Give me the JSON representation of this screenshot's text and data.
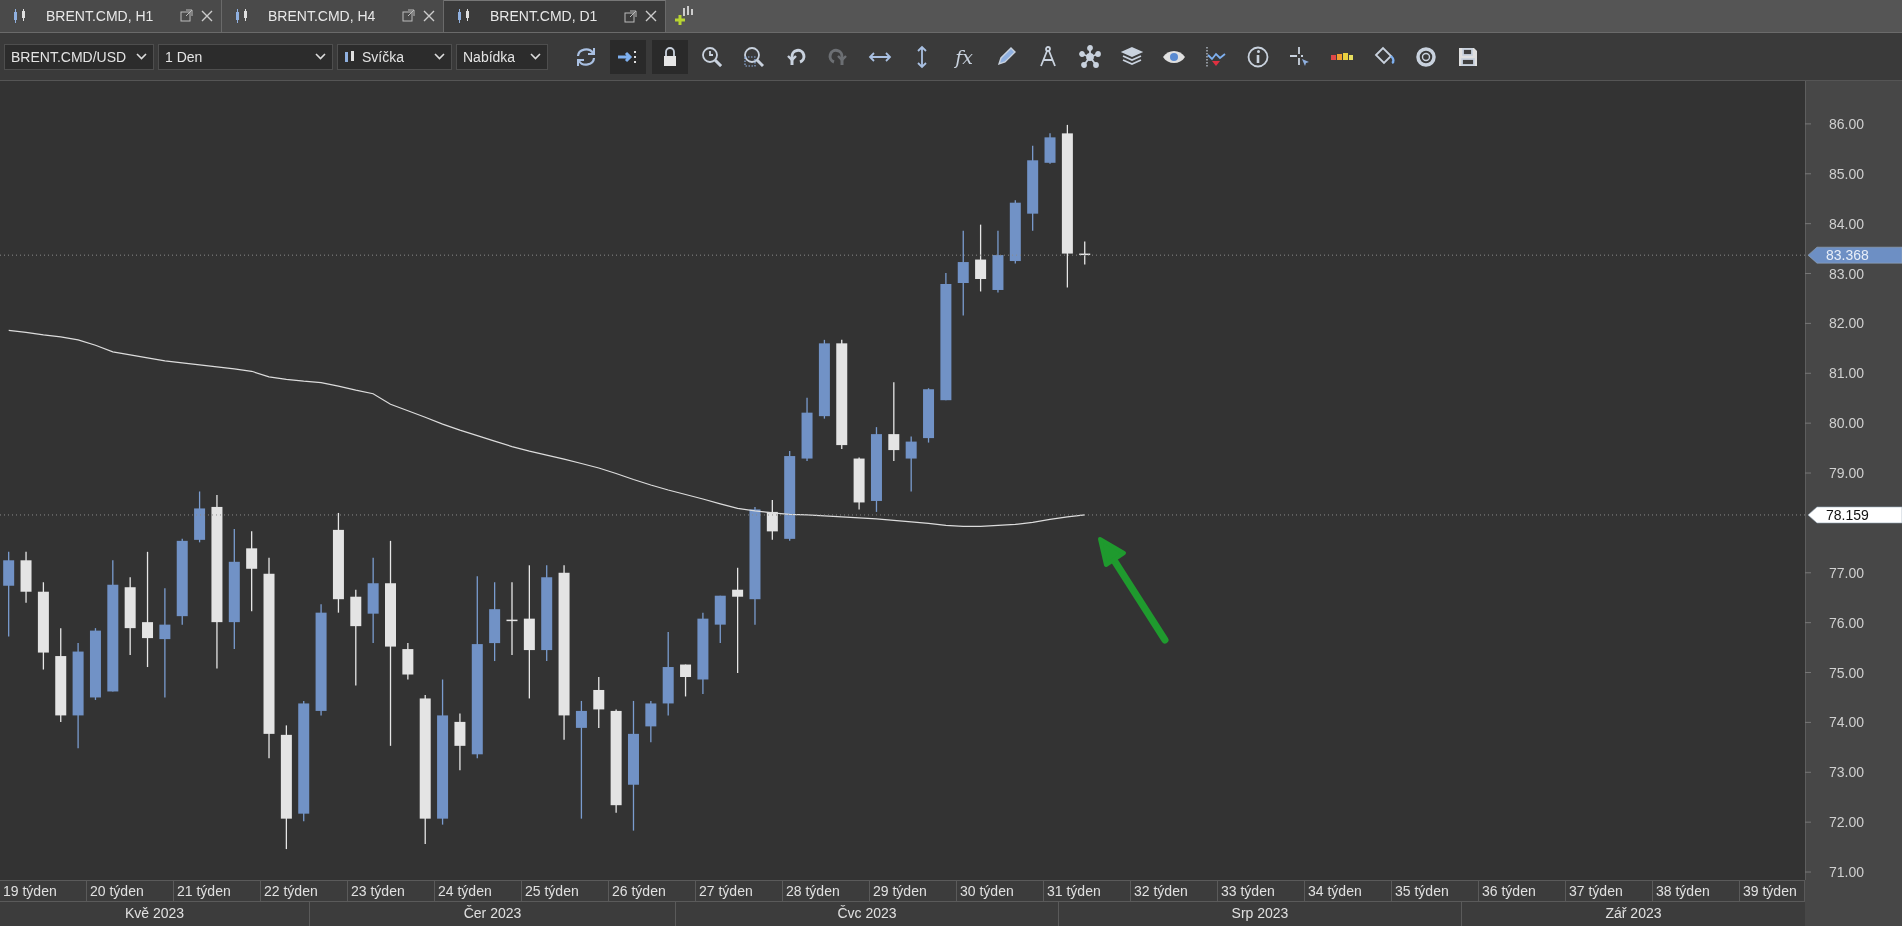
{
  "tabs": [
    {
      "label": "BRENT.CMD, H1",
      "selected": false
    },
    {
      "label": "BRENT.CMD, H4",
      "selected": false
    },
    {
      "label": "BRENT.CMD, D1",
      "selected": true
    }
  ],
  "toolbar": {
    "dropdowns": [
      {
        "kind": "plain",
        "value": "BRENT.CMD/USD"
      },
      {
        "kind": "plain",
        "value": "1 Den"
      },
      {
        "kind": "chart-type",
        "value": "Svíčka"
      },
      {
        "kind": "plain",
        "value": "Nabídka"
      }
    ],
    "tools": [
      {
        "kind": "refresh",
        "pressed": false,
        "disabled": false
      },
      {
        "kind": "autoscroll",
        "pressed": true,
        "disabled": false
      },
      {
        "kind": "lock",
        "pressed": true,
        "disabled": false
      },
      {
        "kind": "zoom-in",
        "pressed": false,
        "disabled": false
      },
      {
        "kind": "zoom-area",
        "pressed": false,
        "disabled": false
      },
      {
        "kind": "undo",
        "pressed": false,
        "disabled": false
      },
      {
        "kind": "redo",
        "pressed": false,
        "disabled": true
      },
      {
        "kind": "fit-horizontal",
        "pressed": false,
        "disabled": false
      },
      {
        "kind": "fit-vertical",
        "pressed": false,
        "disabled": false
      },
      {
        "kind": "formula",
        "label": "fx",
        "pressed": false,
        "disabled": false
      },
      {
        "kind": "pencil",
        "pressed": false,
        "disabled": false
      },
      {
        "kind": "compass",
        "pressed": false,
        "disabled": false
      },
      {
        "kind": "nodes",
        "pressed": false,
        "disabled": false
      },
      {
        "kind": "layers",
        "pressed": false,
        "disabled": false
      },
      {
        "kind": "eye",
        "pressed": false,
        "disabled": false
      },
      {
        "kind": "wave",
        "pressed": false,
        "disabled": false
      },
      {
        "kind": "info",
        "pressed": false,
        "disabled": false
      },
      {
        "kind": "crosshair",
        "pressed": false,
        "disabled": false
      },
      {
        "kind": "color-bar",
        "pressed": false,
        "disabled": false
      },
      {
        "kind": "bucket",
        "pressed": false,
        "disabled": false
      },
      {
        "kind": "aperture",
        "pressed": false,
        "disabled": false
      },
      {
        "kind": "save",
        "pressed": false,
        "disabled": false
      }
    ]
  },
  "chart": {
    "chart_data": {
      "type": "candlestick",
      "ylim": [
        70.84,
        86.86
      ],
      "yticks": [
        {
          "value": 86,
          "label": "86.00"
        },
        {
          "value": 85,
          "label": "85.00"
        },
        {
          "value": 84,
          "label": "84.00"
        },
        {
          "value": 83,
          "label": "83.00"
        },
        {
          "value": 82,
          "label": "82.00"
        },
        {
          "value": 81,
          "label": "81.00"
        },
        {
          "value": 80,
          "label": "80.00"
        },
        {
          "value": 79,
          "label": "79.00"
        },
        {
          "value": 77,
          "label": "77.00"
        },
        {
          "value": 76,
          "label": "76.00"
        },
        {
          "value": 75,
          "label": "75.00"
        },
        {
          "value": 74,
          "label": "74.00"
        },
        {
          "value": 73,
          "label": "73.00"
        },
        {
          "value": 72,
          "label": "72.00"
        },
        {
          "value": 71,
          "label": "71.00"
        }
      ],
      "categories": [
        null,
        null,
        null,
        null,
        null,
        null,
        null,
        null,
        null,
        null,
        null,
        null,
        null,
        null,
        null,
        null,
        null,
        null,
        null,
        null,
        null,
        null,
        null,
        null,
        null,
        null,
        null,
        null,
        null,
        null,
        null,
        null,
        null,
        null,
        null,
        null,
        null,
        null,
        null,
        null,
        null,
        null,
        null,
        null,
        null,
        null,
        null,
        null,
        null,
        null,
        null,
        null,
        null,
        null,
        null,
        null,
        null,
        null,
        null,
        null,
        null,
        null,
        null,
        null,
        null,
        null,
        null,
        null,
        null,
        null,
        null,
        null,
        null,
        null,
        null,
        null,
        null,
        null,
        null,
        null,
        null,
        null,
        null,
        null,
        null,
        null,
        null,
        null,
        null,
        null,
        null,
        null,
        null,
        null,
        null,
        null,
        null,
        null,
        null,
        null,
        null,
        null,
        null,
        null
      ],
      "ohlc": [
        [
          76.74,
          77.42,
          75.72,
          77.25
        ],
        [
          77.25,
          77.42,
          76.4,
          76.62
        ],
        [
          76.62,
          76.81,
          75.06,
          75.4
        ],
        [
          75.33,
          75.89,
          74.01,
          74.14
        ],
        [
          74.14,
          75.59,
          73.48,
          75.42
        ],
        [
          74.5,
          75.89,
          74.45,
          75.84
        ],
        [
          74.62,
          77.25,
          74.62,
          76.76
        ],
        [
          76.71,
          76.91,
          75.35,
          75.89
        ],
        [
          76.01,
          77.42,
          75.11,
          75.69
        ],
        [
          75.67,
          76.69,
          74.5,
          75.96
        ],
        [
          76.13,
          77.68,
          75.96,
          77.64
        ],
        [
          77.66,
          78.63,
          77.61,
          78.29
        ],
        [
          78.32,
          78.56,
          75.08,
          76.01
        ],
        [
          76.01,
          77.88,
          75.47,
          77.22
        ],
        [
          77.49,
          77.83,
          76.23,
          77.08
        ],
        [
          76.98,
          77.3,
          73.28,
          73.77
        ],
        [
          73.75,
          73.94,
          71.46,
          72.07
        ],
        [
          72.17,
          74.43,
          72.02,
          74.38
        ],
        [
          74.23,
          76.37,
          74.14,
          76.2
        ],
        [
          77.86,
          78.2,
          76.2,
          76.47
        ],
        [
          76.52,
          76.66,
          74.74,
          75.93
        ],
        [
          76.18,
          77.3,
          75.59,
          76.79
        ],
        [
          76.79,
          77.64,
          73.53,
          75.52
        ],
        [
          75.47,
          75.59,
          74.86,
          74.96
        ],
        [
          74.48,
          74.55,
          71.56,
          72.07
        ],
        [
          72.07,
          74.86,
          71.95,
          74.14
        ],
        [
          74.01,
          74.18,
          73.04,
          73.53
        ],
        [
          73.36,
          76.93,
          73.28,
          75.57
        ],
        [
          75.59,
          76.81,
          75.23,
          76.27
        ],
        [
          76.06,
          76.81,
          75.35,
          76.03
        ],
        [
          76.08,
          77.15,
          74.48,
          75.45
        ],
        [
          75.45,
          77.15,
          75.23,
          76.91
        ],
        [
          77.0,
          77.15,
          73.65,
          74.14
        ],
        [
          73.89,
          74.43,
          72.07,
          74.23
        ],
        [
          74.65,
          74.91,
          73.89,
          74.26
        ],
        [
          74.23,
          74.26,
          72.19,
          72.34
        ],
        [
          72.75,
          74.43,
          71.83,
          73.77
        ],
        [
          73.92,
          74.43,
          73.6,
          74.38
        ],
        [
          74.38,
          75.81,
          74.14,
          75.11
        ],
        [
          75.16,
          75.16,
          74.52,
          74.91
        ],
        [
          74.86,
          76.2,
          74.57,
          76.08
        ],
        [
          75.96,
          76.54,
          75.59,
          76.54
        ],
        [
          76.66,
          77.1,
          74.99,
          76.52
        ],
        [
          76.47,
          78.32,
          75.96,
          78.27
        ],
        [
          78.22,
          78.46,
          77.66,
          77.83
        ],
        [
          77.68,
          79.44,
          77.64,
          79.34
        ],
        [
          79.29,
          80.51,
          79.24,
          80.21
        ],
        [
          80.14,
          81.67,
          80.09,
          81.6
        ],
        [
          81.6,
          81.67,
          79.48,
          79.56
        ],
        [
          79.29,
          79.31,
          78.27,
          78.41
        ],
        [
          78.44,
          79.92,
          78.22,
          79.78
        ],
        [
          79.78,
          80.82,
          79.24,
          79.46
        ],
        [
          79.29,
          79.73,
          78.63,
          79.63
        ],
        [
          79.7,
          80.7,
          79.61,
          80.68
        ],
        [
          80.46,
          83.01,
          80.46,
          82.79
        ],
        [
          82.81,
          83.86,
          82.16,
          83.23
        ],
        [
          83.28,
          83.98,
          82.64,
          82.89
        ],
        [
          82.67,
          83.86,
          82.62,
          83.37
        ],
        [
          83.25,
          84.47,
          83.2,
          84.42
        ],
        [
          84.2,
          85.56,
          83.86,
          85.27
        ],
        [
          85.22,
          85.81,
          85.2,
          85.73
        ],
        [
          85.81,
          85.98,
          82.72,
          83.4
        ],
        [
          83.4,
          83.64,
          83.18,
          83.37
        ],
        null,
        null,
        null,
        null,
        null,
        null,
        null,
        null,
        null,
        null,
        null,
        null,
        null,
        null,
        null,
        null,
        null,
        null,
        null,
        null,
        null,
        null,
        null,
        null,
        null,
        null,
        null,
        null,
        null,
        null,
        null,
        null,
        null,
        null,
        null,
        null,
        null,
        null,
        null,
        null,
        null
      ],
      "series": [
        {
          "type": "line",
          "color": "#dcdcdc",
          "values": [
            81.86,
            81.82,
            81.77,
            81.73,
            81.67,
            81.56,
            81.43,
            81.37,
            81.31,
            81.25,
            81.21,
            81.17,
            81.13,
            81.09,
            81.04,
            80.93,
            80.88,
            80.84,
            80.81,
            80.74,
            80.66,
            80.59,
            80.38,
            80.25,
            80.12,
            79.98,
            79.86,
            79.75,
            79.64,
            79.53,
            79.44,
            79.36,
            79.28,
            79.19,
            79.1,
            78.99,
            78.87,
            78.76,
            78.66,
            78.57,
            78.48,
            78.38,
            78.29,
            78.24,
            78.2,
            78.17,
            78.16,
            78.14,
            78.12,
            78.1,
            78.08,
            78.05,
            78.02,
            77.99,
            77.95,
            77.93,
            77.93,
            77.95,
            77.97,
            78.01,
            78.07,
            78.12,
            78.16,
            null,
            null,
            null,
            null,
            null,
            null,
            null,
            null,
            null,
            null,
            null,
            null,
            null,
            null,
            null,
            null,
            null,
            null,
            null,
            null,
            null,
            null,
            null,
            null,
            null,
            null,
            null,
            null,
            null,
            null,
            null,
            null,
            null,
            null,
            null,
            null,
            null,
            null,
            null,
            null,
            null
          ]
        }
      ],
      "ref_lines": [
        {
          "axis": "y",
          "value": 83.368,
          "label": "83.368"
        },
        {
          "axis": "y",
          "value": 78.159,
          "label": "78.159"
        }
      ]
    },
    "weeks": [
      "19 týden",
      "20 týden",
      "21 týden",
      "22 týden",
      "23 týden",
      "24 týden",
      "25 týden",
      "26 týden",
      "27 týden",
      "28 týden",
      "29 týden",
      "30 týden",
      "31 týden",
      "32 týden",
      "33 týden",
      "34 týden",
      "35 týden",
      "36 týden",
      "37 týden",
      "38 týden",
      "39 týden"
    ],
    "months": [
      "Kvě 2023",
      "Čer 2023",
      "Čvc 2023",
      "Srp 2023",
      "Zář 2023"
    ]
  }
}
